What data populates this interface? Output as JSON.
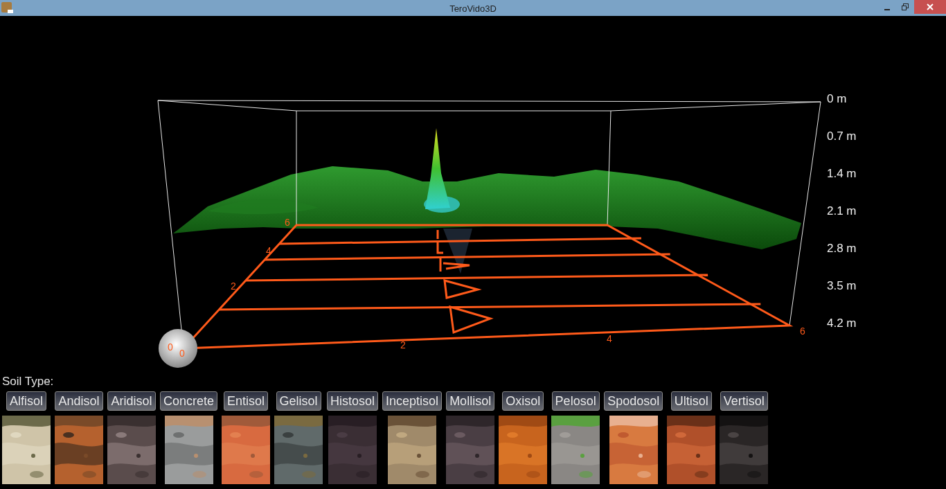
{
  "window": {
    "title": "TeroVido3D"
  },
  "scene": {
    "depth_labels": [
      "0 m",
      "0.7 m",
      "1.4 m",
      "2.1 m",
      "2.8 m",
      "3.5 m",
      "4.2 m"
    ],
    "side_axis_labels": [
      "6",
      "4",
      "2",
      "0"
    ],
    "front_axis_labels": [
      "0",
      "2",
      "4",
      "6"
    ]
  },
  "soil_panel": {
    "label": "Soil Type:",
    "soil_types": [
      {
        "label": "Alfisol",
        "kind": "picture"
      },
      {
        "label": "Andisol",
        "kind": "picture"
      },
      {
        "label": "Aridisol",
        "kind": "picture"
      },
      {
        "label": "Concrete",
        "kind": "picture"
      },
      {
        "label": "Entisol",
        "kind": "picture"
      },
      {
        "label": "Gelisol",
        "kind": "picture"
      },
      {
        "label": "Histosol",
        "kind": "picture"
      },
      {
        "label": "Inceptisol",
        "kind": "picture"
      },
      {
        "label": "Mollisol",
        "kind": "picture"
      },
      {
        "label": "Oxisol",
        "kind": "picture"
      },
      {
        "label": "Pelosol",
        "kind": "picture"
      },
      {
        "label": "Spodosol",
        "kind": "picture"
      },
      {
        "label": "Ultisol",
        "kind": "picture"
      },
      {
        "label": "Vertisol",
        "kind": "picture"
      }
    ]
  }
}
